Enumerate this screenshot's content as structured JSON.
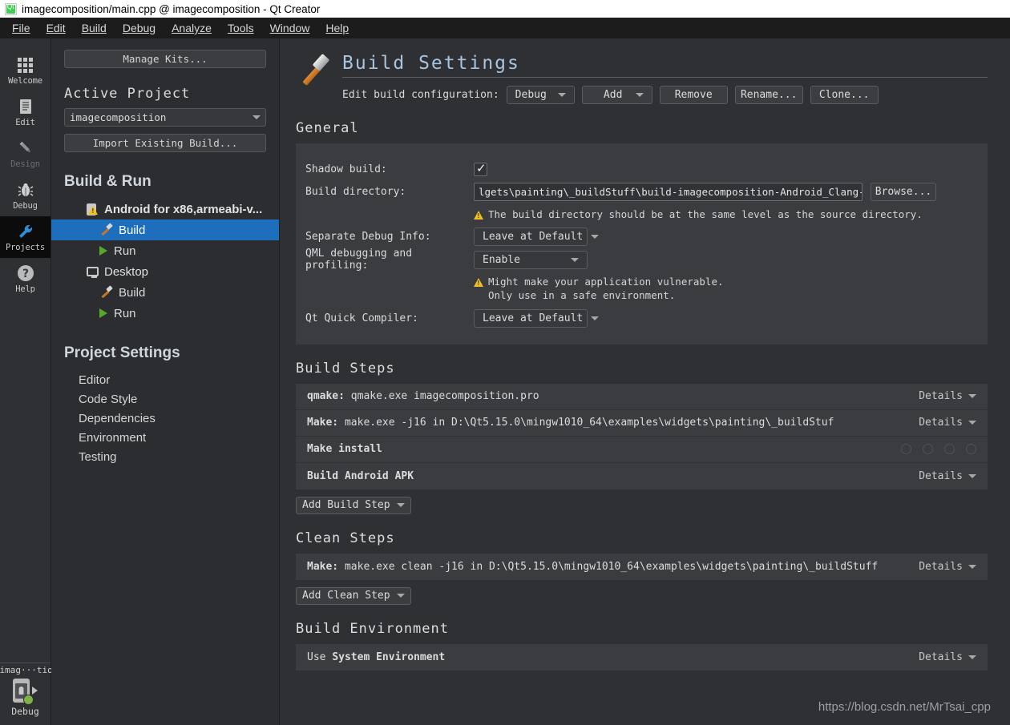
{
  "window": {
    "title": "imagecomposition/main.cpp @ imagecomposition - Qt Creator",
    "logo_icon": "qt-logo-icon"
  },
  "menubar": {
    "items": [
      {
        "label": "File"
      },
      {
        "label": "Edit"
      },
      {
        "label": "Build"
      },
      {
        "label": "Debug"
      },
      {
        "label": "Analyze"
      },
      {
        "label": "Tools"
      },
      {
        "label": "Window"
      },
      {
        "label": "Help"
      }
    ]
  },
  "modebar": {
    "modes": [
      {
        "label": "Welcome",
        "icon": "grid-icon",
        "state": "normal"
      },
      {
        "label": "Edit",
        "icon": "document-icon",
        "state": "normal"
      },
      {
        "label": "Design",
        "icon": "pencil-icon",
        "state": "disabled"
      },
      {
        "label": "Debug",
        "icon": "bug-icon",
        "state": "normal"
      },
      {
        "label": "Projects",
        "icon": "wrench-icon",
        "state": "active"
      },
      {
        "label": "Help",
        "icon": "question-mark-icon",
        "state": "normal"
      }
    ],
    "kit_selector": {
      "project": "imag···tion",
      "device_icon": "android-device-icon",
      "status_icon": "green-dot-icon",
      "run_icon": "run-arrow-icon",
      "build_config": "Debug"
    }
  },
  "sidebar": {
    "manage_kits_label": "Manage Kits...",
    "active_project_heading": "Active Project",
    "project_combo_value": "imagecomposition",
    "import_build_label": "Import Existing Build...",
    "build_run_heading": "Build & Run",
    "kits": [
      {
        "name": "Android for x86,armeabi-v...",
        "icon": "android-warning-icon",
        "children": [
          {
            "label": "Build",
            "icon": "hammer-icon",
            "selected": true
          },
          {
            "label": "Run",
            "icon": "play-icon",
            "selected": false
          }
        ]
      },
      {
        "name": "Desktop",
        "icon": "monitor-icon",
        "children": [
          {
            "label": "Build",
            "icon": "hammer-icon",
            "selected": false
          },
          {
            "label": "Run",
            "icon": "play-icon",
            "selected": false
          }
        ]
      }
    ],
    "project_settings_heading": "Project Settings",
    "project_settings_items": [
      {
        "label": "Editor"
      },
      {
        "label": "Code Style"
      },
      {
        "label": "Dependencies"
      },
      {
        "label": "Environment"
      },
      {
        "label": "Testing"
      }
    ]
  },
  "main": {
    "page_title": "Build Settings",
    "page_icon": "hammer-icon",
    "config_row": {
      "label": "Edit build configuration:",
      "config_value": "Debug",
      "add_label": "Add",
      "remove_label": "Remove",
      "rename_label": "Rename...",
      "clone_label": "Clone..."
    },
    "general": {
      "heading": "General",
      "shadow_build_label": "Shadow build:",
      "shadow_build_checked": "✓",
      "build_directory_label": "Build directory:",
      "build_directory_value": "lgets\\painting\\_buildStuff\\build-imagecomposition-Android_Clang-Debug",
      "browse_label": "Browse...",
      "build_dir_warning": "The build directory should be at the same level as the source directory.",
      "separate_debug_label": "Separate Debug Info:",
      "separate_debug_value": "Leave at Default",
      "qml_debug_label": "QML debugging and profiling:",
      "qml_debug_value": "Enable",
      "qml_warning_line1": "Might make your application vulnerable.",
      "qml_warning_line2": "Only use in a safe environment.",
      "qt_quick_compiler_label": "Qt Quick Compiler:",
      "qt_quick_compiler_value": "Leave at Default"
    },
    "build_steps": {
      "heading": "Build Steps",
      "steps": [
        {
          "bold": "qmake:",
          "rest": " qmake.exe imagecomposition.pro",
          "details": "Details",
          "has_details": true
        },
        {
          "bold": "Make:",
          "rest": " make.exe -j16 in D:\\Qt5.15.0\\mingw1010_64\\examples\\widgets\\painting\\_buildStuf",
          "details": "Details",
          "has_details": true
        },
        {
          "bold": "Make install",
          "rest": "",
          "details": "",
          "has_details": false
        },
        {
          "bold": "Build Android APK",
          "rest": "",
          "details": "Details",
          "has_details": true
        }
      ],
      "add_label": "Add Build Step"
    },
    "clean_steps": {
      "heading": "Clean Steps",
      "steps": [
        {
          "bold": "Make:",
          "rest": " make.exe clean -j16 in D:\\Qt5.15.0\\mingw1010_64\\examples\\widgets\\painting\\_buildStuff",
          "details": "Details",
          "has_details": true
        }
      ],
      "add_label": "Add Clean Step"
    },
    "build_environment": {
      "heading": "Build Environment",
      "row_prefix": "Use ",
      "row_bold": "System Environment",
      "details": "Details"
    }
  },
  "watermark": "https://blog.csdn.net/MrTsai_cpp",
  "colors": {
    "accent_selection": "#1d6fbd",
    "title_blue": "#a8c4de",
    "warning_yellow": "#f0c020",
    "run_green": "#5aa72a",
    "hammer_orange": "#c8752a",
    "panel_bg": "#3a3c3f",
    "page_bg": "#2e3033"
  }
}
